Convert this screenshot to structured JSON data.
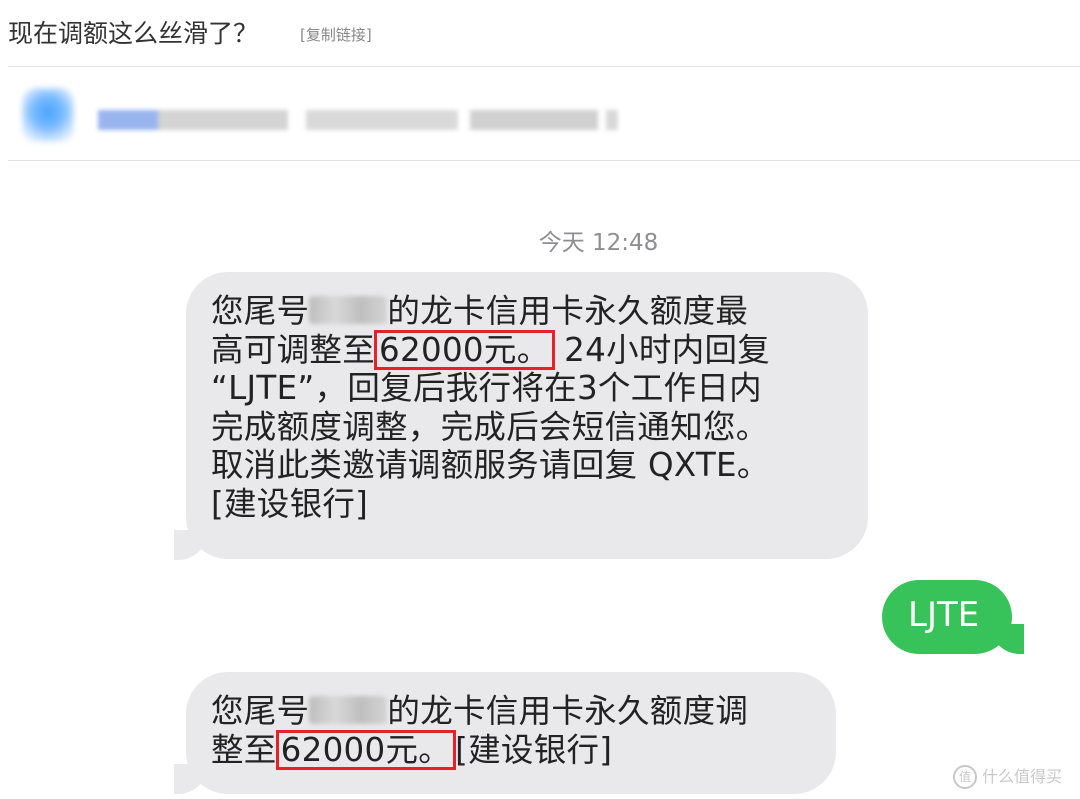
{
  "header": {
    "title": "现在调额这么丝滑了？",
    "copy_link": "[复制链接]"
  },
  "thread": {
    "timestamp": "今天 12:48",
    "msg1": {
      "l1_a": "您尾号",
      "l1_b": "的龙卡信用卡永久额度最",
      "l2_a": "高可调整至",
      "l2_amount": "62000元。",
      "l2_b": " 24小时内回复",
      "l3": "“LJTE”，回复后我行将在3个工作日内",
      "l4": "完成额度调整，完成后会短信通知您。",
      "l5": "取消此类邀请调额服务请回复 QXTE。",
      "l6": "[建设银行]"
    },
    "reply": "LJTE",
    "msg2": {
      "l1_a": "您尾号",
      "l1_b": "的龙卡信用卡永久额度调",
      "l2_a": "整至",
      "l2_amount": "62000元。",
      "l2_b": "[建设银行]"
    }
  },
  "watermark": {
    "icon": "值",
    "text": "什么值得买"
  },
  "colors": {
    "incoming_bubble": "#e9e9eb",
    "outgoing_bubble": "#37c35a",
    "highlight_box": "#e8202a"
  }
}
